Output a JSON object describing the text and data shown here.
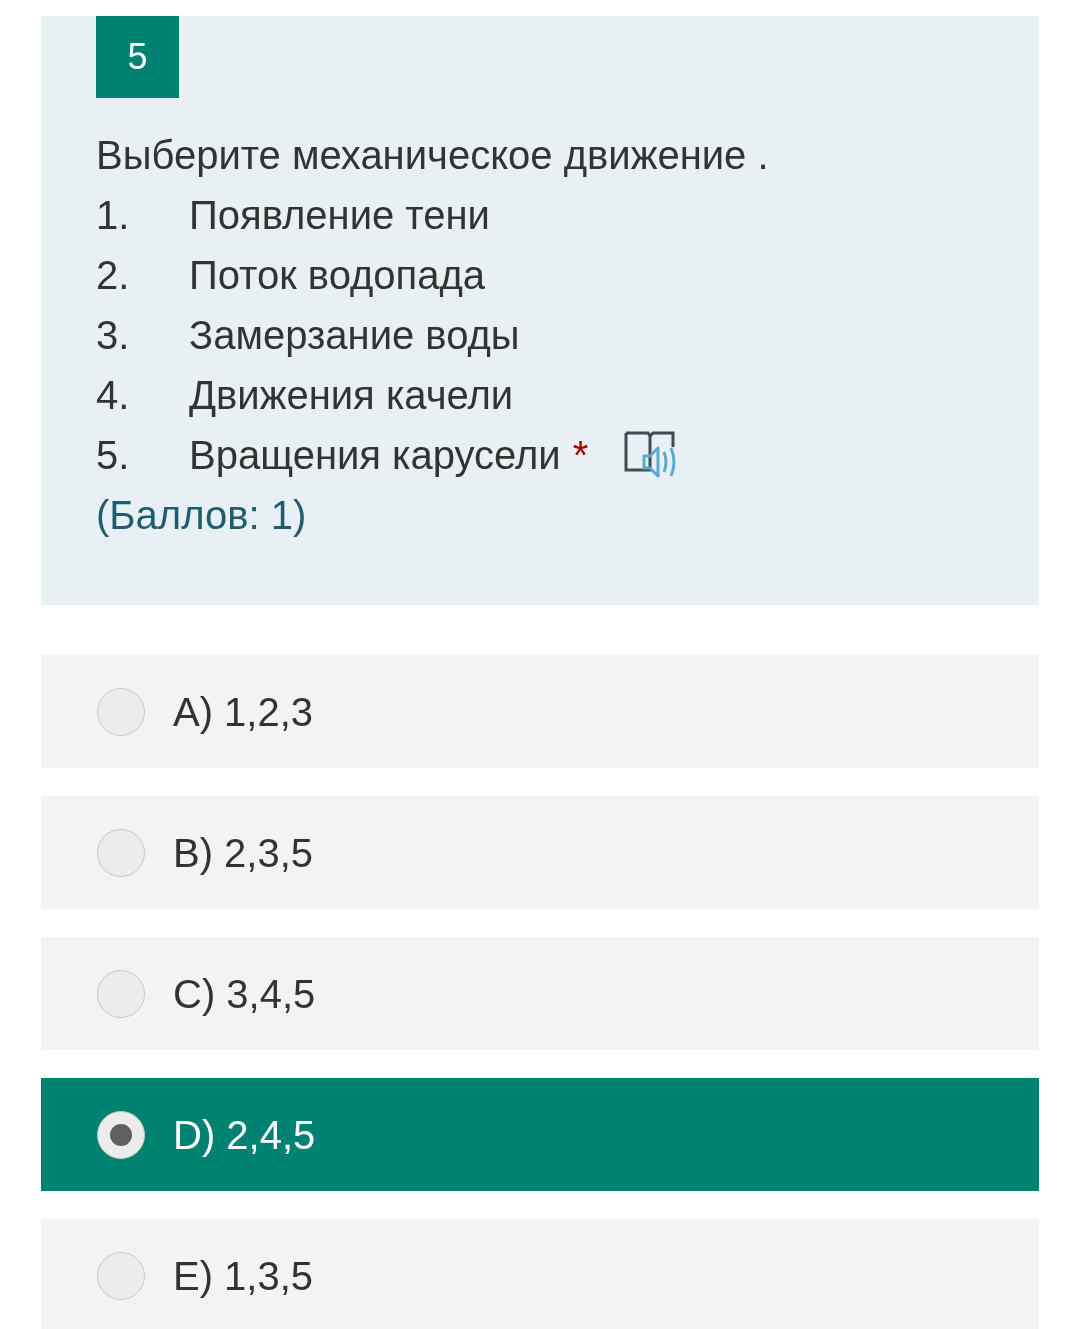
{
  "question": {
    "number": "5",
    "title": "Выберите механическое движение .",
    "items": [
      {
        "number": "1.",
        "text": "Появление тени"
      },
      {
        "number": "2.",
        "text": "Поток водопада"
      },
      {
        "number": "3.",
        "text": "Замерзание воды"
      },
      {
        "number": "4.",
        "text": "Движения качели"
      },
      {
        "number": "5.",
        "text": "Вращения карусели"
      }
    ],
    "required_mark": "*",
    "points": "(Баллов: 1)"
  },
  "options": [
    {
      "label": "A) 1,2,3",
      "selected": false
    },
    {
      "label": "B) 2,3,5",
      "selected": false
    },
    {
      "label": "C) 3,4,5",
      "selected": false
    },
    {
      "label": "D) 2,4,5",
      "selected": true
    },
    {
      "label": "E) 1,3,5",
      "selected": false
    }
  ]
}
